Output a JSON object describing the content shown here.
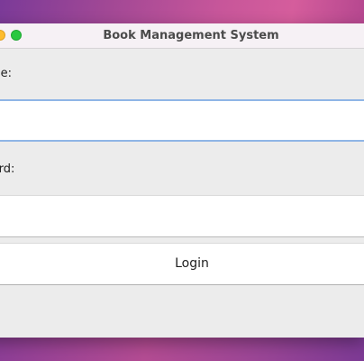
{
  "window": {
    "title": "Book Management System"
  },
  "form": {
    "username_label": "ame:",
    "username_value": "",
    "password_label": "word:",
    "password_value": "",
    "login_label": "Login"
  },
  "colors": {
    "focus_ring": "#8fb5e6",
    "window_bg": "#ececec",
    "titlebar_bg": "#f6f1f5",
    "minimize": "#febc2e",
    "zoom": "#28c840"
  },
  "icons": {
    "minimize": "minimize-icon",
    "zoom": "zoom-icon"
  }
}
